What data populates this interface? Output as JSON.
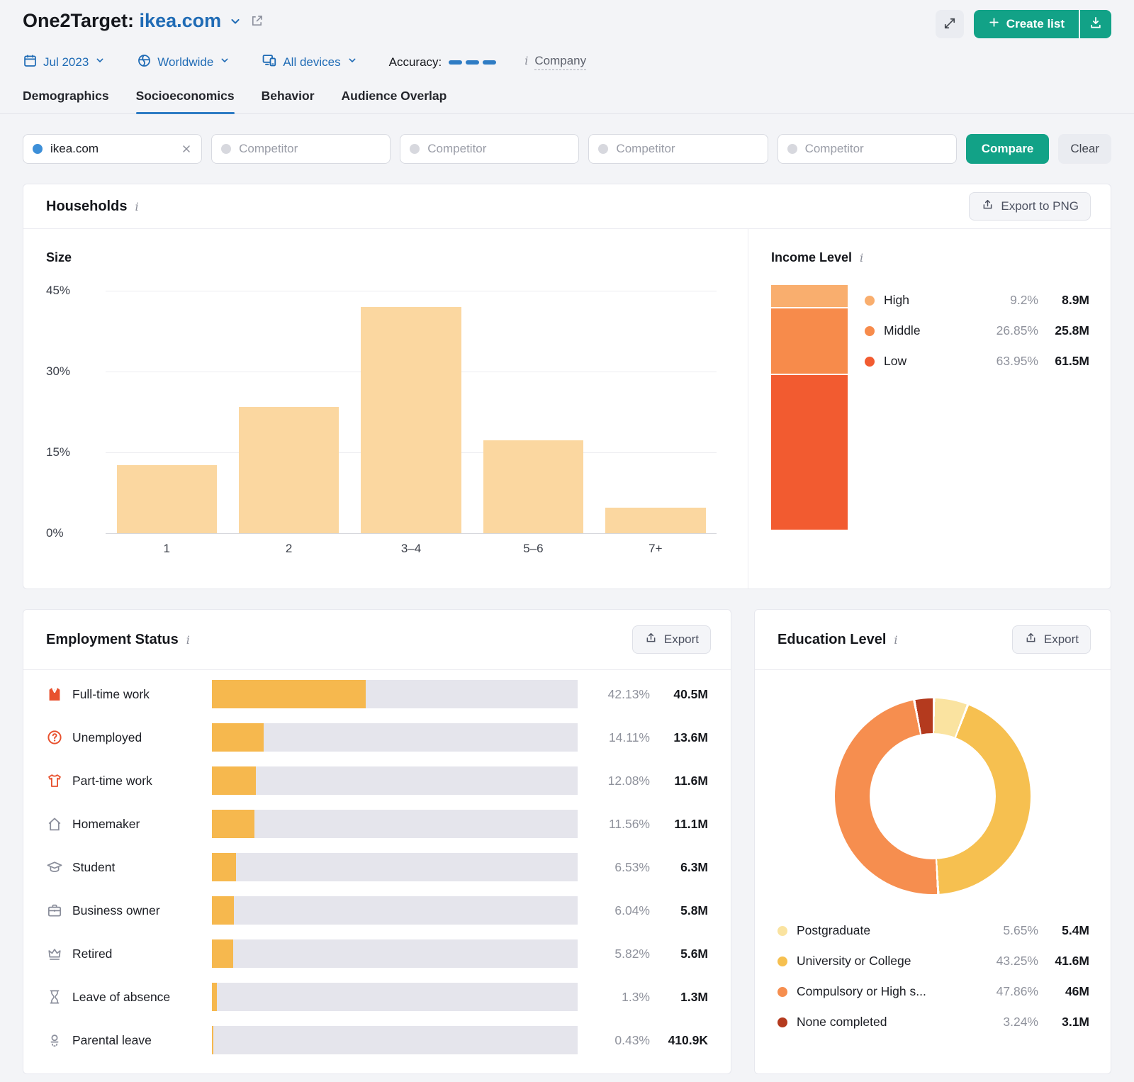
{
  "header": {
    "title": "One2Target:",
    "target_domain": "ikea.com",
    "create_list_label": "Create list"
  },
  "filters": {
    "date": "Jul 2023",
    "location": "Worldwide",
    "devices": "All devices",
    "accuracy_label": "Accuracy:",
    "company_link": "Company"
  },
  "tabs": [
    {
      "label": "Demographics",
      "active": false
    },
    {
      "label": "Socioeconomics",
      "active": true
    },
    {
      "label": "Behavior",
      "active": false
    },
    {
      "label": "Audience Overlap",
      "active": false
    }
  ],
  "compare": {
    "target": "ikea.com",
    "competitor_placeholder": "Competitor",
    "compare_label": "Compare",
    "clear_label": "Clear"
  },
  "households": {
    "title": "Households",
    "export_label": "Export to PNG",
    "size_title": "Size",
    "income_title": "Income Level"
  },
  "employment": {
    "title": "Employment Status",
    "export_label": "Export"
  },
  "education": {
    "title": "Education Level",
    "export_label": "Export"
  },
  "chart_data": [
    {
      "id": "household_size",
      "type": "bar",
      "title": "Size",
      "categories": [
        "1",
        "2",
        "3–4",
        "5–6",
        "7+"
      ],
      "values": [
        12.6,
        23.4,
        42.0,
        17.3,
        4.7
      ],
      "ylim": [
        0,
        45
      ],
      "yticks": [
        {
          "label": "45%",
          "value": 45
        },
        {
          "label": "30%",
          "value": 30
        },
        {
          "label": "15%",
          "value": 15
        },
        {
          "label": "0%",
          "value": 0
        }
      ],
      "bar_color": "#fbd7a0",
      "grid": true,
      "legend_position": "none"
    },
    {
      "id": "income_level",
      "type": "stacked-bar",
      "title": "Income Level",
      "segments": [
        {
          "label": "High",
          "pct": 9.2,
          "pct_label": "9.2%",
          "value": "8.9M",
          "color": "#f9ae6e"
        },
        {
          "label": "Middle",
          "pct": 26.85,
          "pct_label": "26.85%",
          "value": "25.8M",
          "color": "#f78b4b"
        },
        {
          "label": "Low",
          "pct": 63.95,
          "pct_label": "63.95%",
          "value": "61.5M",
          "color": "#f25b30"
        }
      ]
    },
    {
      "id": "employment_status",
      "type": "bar-list",
      "title": "Employment Status",
      "bar_color": "#f6b84e",
      "track_color": "#e5e5ec",
      "rows": [
        {
          "icon": "work-vest-icon",
          "label": "Full-time work",
          "pct": 42.13,
          "pct_label": "42.13%",
          "value": "40.5M"
        },
        {
          "icon": "question-circle-icon",
          "label": "Unemployed",
          "pct": 14.11,
          "pct_label": "14.11%",
          "value": "13.6M"
        },
        {
          "icon": "tshirt-icon",
          "label": "Part-time work",
          "pct": 12.08,
          "pct_label": "12.08%",
          "value": "11.6M"
        },
        {
          "icon": "house-icon",
          "label": "Homemaker",
          "pct": 11.56,
          "pct_label": "11.56%",
          "value": "11.1M"
        },
        {
          "icon": "graduation-cap-icon",
          "label": "Student",
          "pct": 6.53,
          "pct_label": "6.53%",
          "value": "6.3M"
        },
        {
          "icon": "briefcase-icon",
          "label": "Business owner",
          "pct": 6.04,
          "pct_label": "6.04%",
          "value": "5.8M"
        },
        {
          "icon": "crown-icon",
          "label": "Retired",
          "pct": 5.82,
          "pct_label": "5.82%",
          "value": "5.6M"
        },
        {
          "icon": "hourglass-icon",
          "label": "Leave of absence",
          "pct": 1.3,
          "pct_label": "1.3%",
          "value": "1.3M"
        },
        {
          "icon": "pacifier-icon",
          "label": "Parental leave",
          "pct": 0.43,
          "pct_label": "0.43%",
          "value": "410.9K"
        }
      ]
    },
    {
      "id": "education_level",
      "type": "donut",
      "title": "Education Level",
      "slices": [
        {
          "label": "Postgraduate",
          "pct": 5.65,
          "pct_label": "5.65%",
          "value": "5.4M",
          "color": "#fae3a0"
        },
        {
          "label": "University or College",
          "pct": 43.25,
          "pct_label": "43.25%",
          "value": "41.6M",
          "color": "#f6c050"
        },
        {
          "label": "Compulsory or High s...",
          "pct": 47.86,
          "pct_label": "47.86%",
          "value": "46M",
          "color": "#f68e4f"
        },
        {
          "label": "None completed",
          "pct": 3.24,
          "pct_label": "3.24%",
          "value": "3.1M",
          "color": "#b43a1e"
        }
      ],
      "legend_position": "bottom"
    }
  ],
  "colors": {
    "accent_green": "#12a287",
    "link_blue": "#1f6bb5",
    "active_tab_blue": "#2e7cc4"
  }
}
